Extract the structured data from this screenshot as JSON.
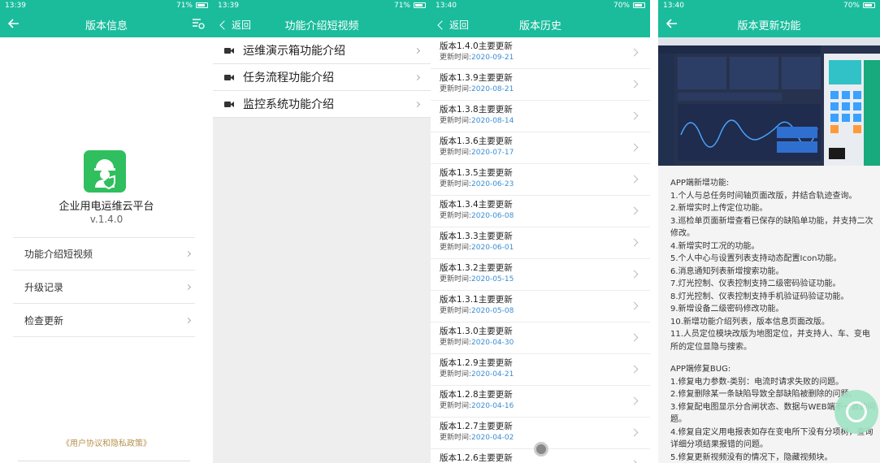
{
  "p1": {
    "status": {
      "left": "13:39",
      "battery": "71%"
    },
    "title": "版本信息",
    "app_name": "企业用电运维云平台",
    "version": "v.1.4.0",
    "menu": [
      "功能介绍短视频",
      "升级记录",
      "检查更新"
    ],
    "policy": "《用户协议和隐私政策》"
  },
  "p2": {
    "status": {
      "left": "13:39",
      "battery": "71%"
    },
    "back": "返回",
    "title": "功能介绍短视频",
    "items": [
      "运维演示箱功能介绍",
      "任务流程功能介绍",
      "监控系统功能介绍"
    ]
  },
  "p3": {
    "status": {
      "left": "13:40",
      "battery": "70%"
    },
    "back": "返回",
    "title": "版本历史",
    "time_label": "更新时间:",
    "items": [
      {
        "v": "版本1.4.0主要更新",
        "d": "2020-09-21"
      },
      {
        "v": "版本1.3.9主要更新",
        "d": "2020-08-21"
      },
      {
        "v": "版本1.3.8主要更新",
        "d": "2020-08-14"
      },
      {
        "v": "版本1.3.6主要更新",
        "d": "2020-07-17"
      },
      {
        "v": "版本1.3.5主要更新",
        "d": "2020-06-23"
      },
      {
        "v": "版本1.3.4主要更新",
        "d": "2020-06-08"
      },
      {
        "v": "版本1.3.3主要更新",
        "d": "2020-06-01"
      },
      {
        "v": "版本1.3.2主要更新",
        "d": "2020-05-15"
      },
      {
        "v": "版本1.3.1主要更新",
        "d": "2020-05-08"
      },
      {
        "v": "版本1.3.0主要更新",
        "d": "2020-04-30"
      },
      {
        "v": "版本1.2.9主要更新",
        "d": "2020-04-21"
      },
      {
        "v": "版本1.2.8主要更新",
        "d": "2020-04-16"
      },
      {
        "v": "版本1.2.7主要更新",
        "d": "2020-04-02"
      },
      {
        "v": "版本1.2.6主要更新",
        "d": ""
      }
    ]
  },
  "p4": {
    "status": {
      "left": "13:40",
      "battery": "70%"
    },
    "title": "版本更新功能",
    "new_heading": "APP端新增功能:",
    "new_items": [
      "1.个人与总任务时间轴页面改版，并结合轨迹查询。",
      "2.新增实时上传定位功能。",
      "3.巡检单页面新增查看已保存的缺陷单功能，并支持二次修改。",
      "4.新增实时工况的功能。",
      "5.个人中心与设置列表支持动态配置Icon功能。",
      "6.消息通知列表新增搜索功能。",
      "7.灯光控制、仪表控制支持二级密码验证功能。",
      "8.灯光控制、仪表控制支持手机验证码验证功能。",
      "9.新增设备二级密码修改功能。",
      "10.新增功能介绍列表，版本信息页面改版。",
      "11.人员定位模块改版为地图定位，并支持人、车、变电所的定位显隐与搜索。"
    ],
    "fix_heading": "APP端修复BUG:",
    "fix_items": [
      "1.修复电力参数-类别：电流时请求失败的问题。",
      "2.修复删除某一条缺陷导致全部缺陷被删除的问题。",
      "3.修复配电图显示分合闸状态、数据与WEB端不一致的问题。",
      "4.修复自定义用电报表如存在变电所下没有分项树，查询详细分项结果报错的问题。",
      "5.修复更新视频没有的情况下，隐藏视频块。"
    ]
  },
  "colors": {
    "teal": "#1abc9c",
    "link_date": "#3a8dd4",
    "policy": "#b89250"
  }
}
